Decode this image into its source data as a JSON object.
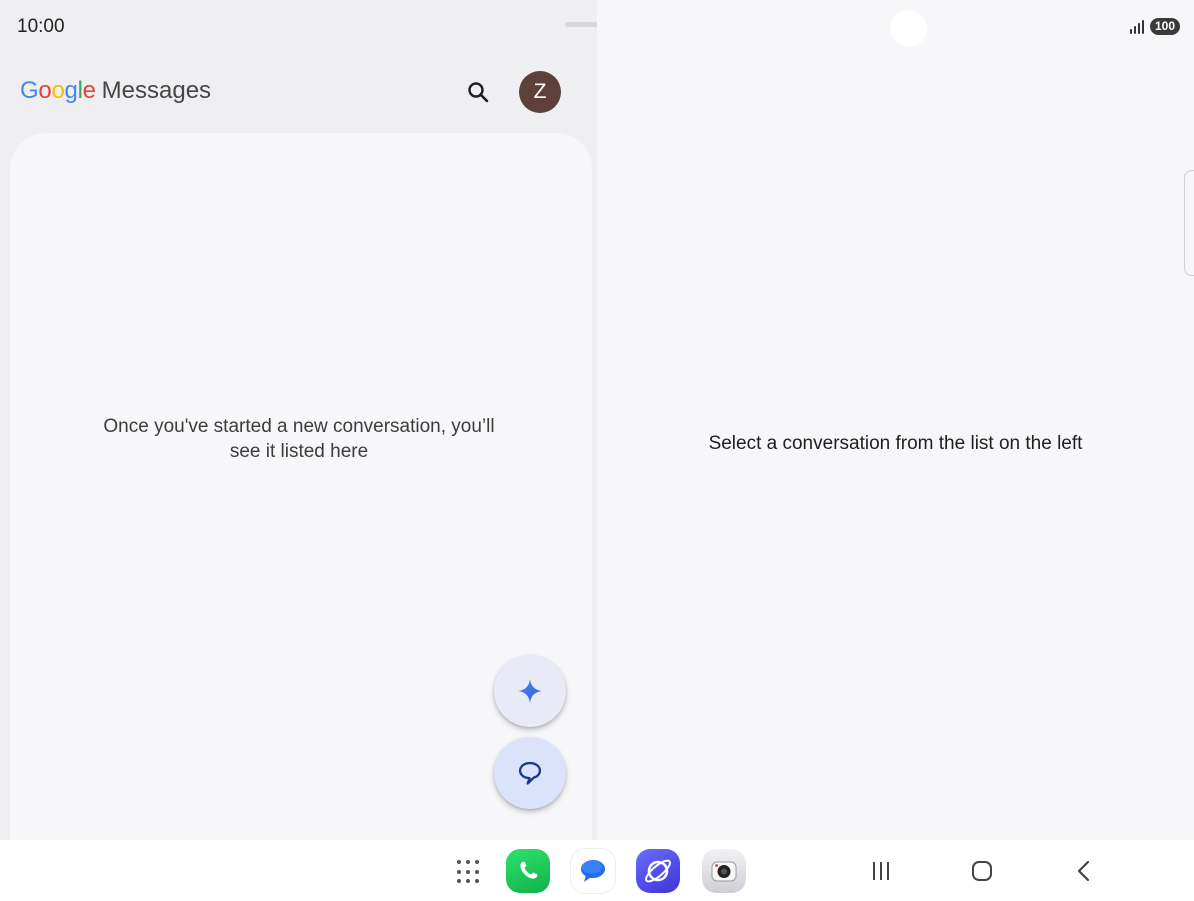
{
  "status_bar": {
    "time": "10:00",
    "battery": "100",
    "icons": [
      "signal-icon",
      "battery-icon"
    ]
  },
  "app_bar": {
    "brand_google": [
      "G",
      "o",
      "o",
      "g",
      "l",
      "e"
    ],
    "brand_messages": "Messages",
    "avatar_letter": "Z",
    "icons": [
      "search-icon"
    ]
  },
  "conversation_list": {
    "empty_line_1": "Once you've started a new conversation, you’ll",
    "empty_line_2": "see it listed here"
  },
  "fabs": {
    "gemini_icon": "sparkle-icon",
    "start_chat_icon": "chat-bubble-icon"
  },
  "detail_pane": {
    "hint": "Select a conversation from the list on the left"
  },
  "taskbar": {
    "apps": [
      "app-drawer-icon",
      "phone-app-icon",
      "messages-app-icon",
      "internet-app-icon",
      "camera-app-icon"
    ],
    "nav": [
      "recents-icon",
      "home-icon",
      "back-icon"
    ]
  },
  "colors": {
    "google_blue": "#4285f4",
    "google_red": "#ea4335",
    "google_yellow": "#fbbc05",
    "google_green": "#34a853",
    "avatar_bg": "#5d4037",
    "fab_start_bg": "#dbe3fb"
  }
}
